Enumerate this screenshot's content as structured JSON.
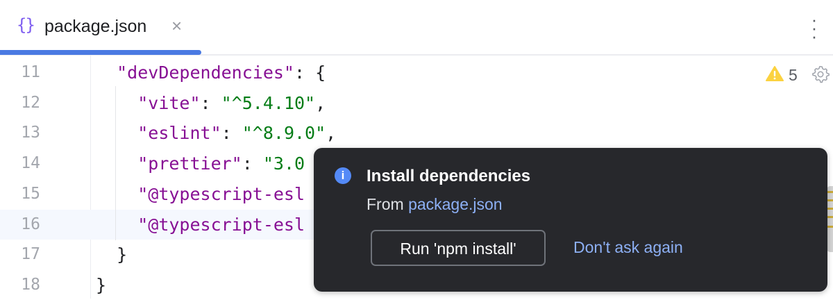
{
  "tab": {
    "icon": "json-braces-icon",
    "icon_text": "{}",
    "label": "package.json",
    "close": "×"
  },
  "toolbar": {
    "more": "⋮"
  },
  "inspections": {
    "warning_count": "5"
  },
  "editor": {
    "lines": [
      {
        "n": "11",
        "indent": "  ",
        "key": "\"devDependencies\"",
        "rest": ": {",
        "val": ""
      },
      {
        "n": "12",
        "indent": "    ",
        "key": "\"vite\"",
        "rest": ": ",
        "val": "\"^5.4.10\"",
        "tail": ","
      },
      {
        "n": "13",
        "indent": "    ",
        "key": "\"eslint\"",
        "rest": ": ",
        "val": "\"^8.9.0\"",
        "tail": ","
      },
      {
        "n": "14",
        "indent": "    ",
        "key": "\"prettier\"",
        "rest": ": ",
        "val": "\"3.0"
      },
      {
        "n": "15",
        "indent": "    ",
        "key": "\"@typescript-esl",
        "rest": "",
        "val": ""
      },
      {
        "n": "16",
        "indent": "    ",
        "key": "\"@typescript-esl",
        "rest": "",
        "val": ""
      },
      {
        "n": "17",
        "indent": "  ",
        "key": "",
        "rest": "}",
        "val": ""
      },
      {
        "n": "18",
        "indent": "",
        "key": "",
        "rest": "}",
        "val": ""
      }
    ]
  },
  "notification": {
    "title": "Install dependencies",
    "from_prefix": "From ",
    "from_link": "package.json",
    "primary": "Run 'npm install'",
    "secondary": "Don't ask again",
    "colors": {
      "bg": "#27282c",
      "link": "#8db0f5",
      "info": "#548af7"
    }
  }
}
